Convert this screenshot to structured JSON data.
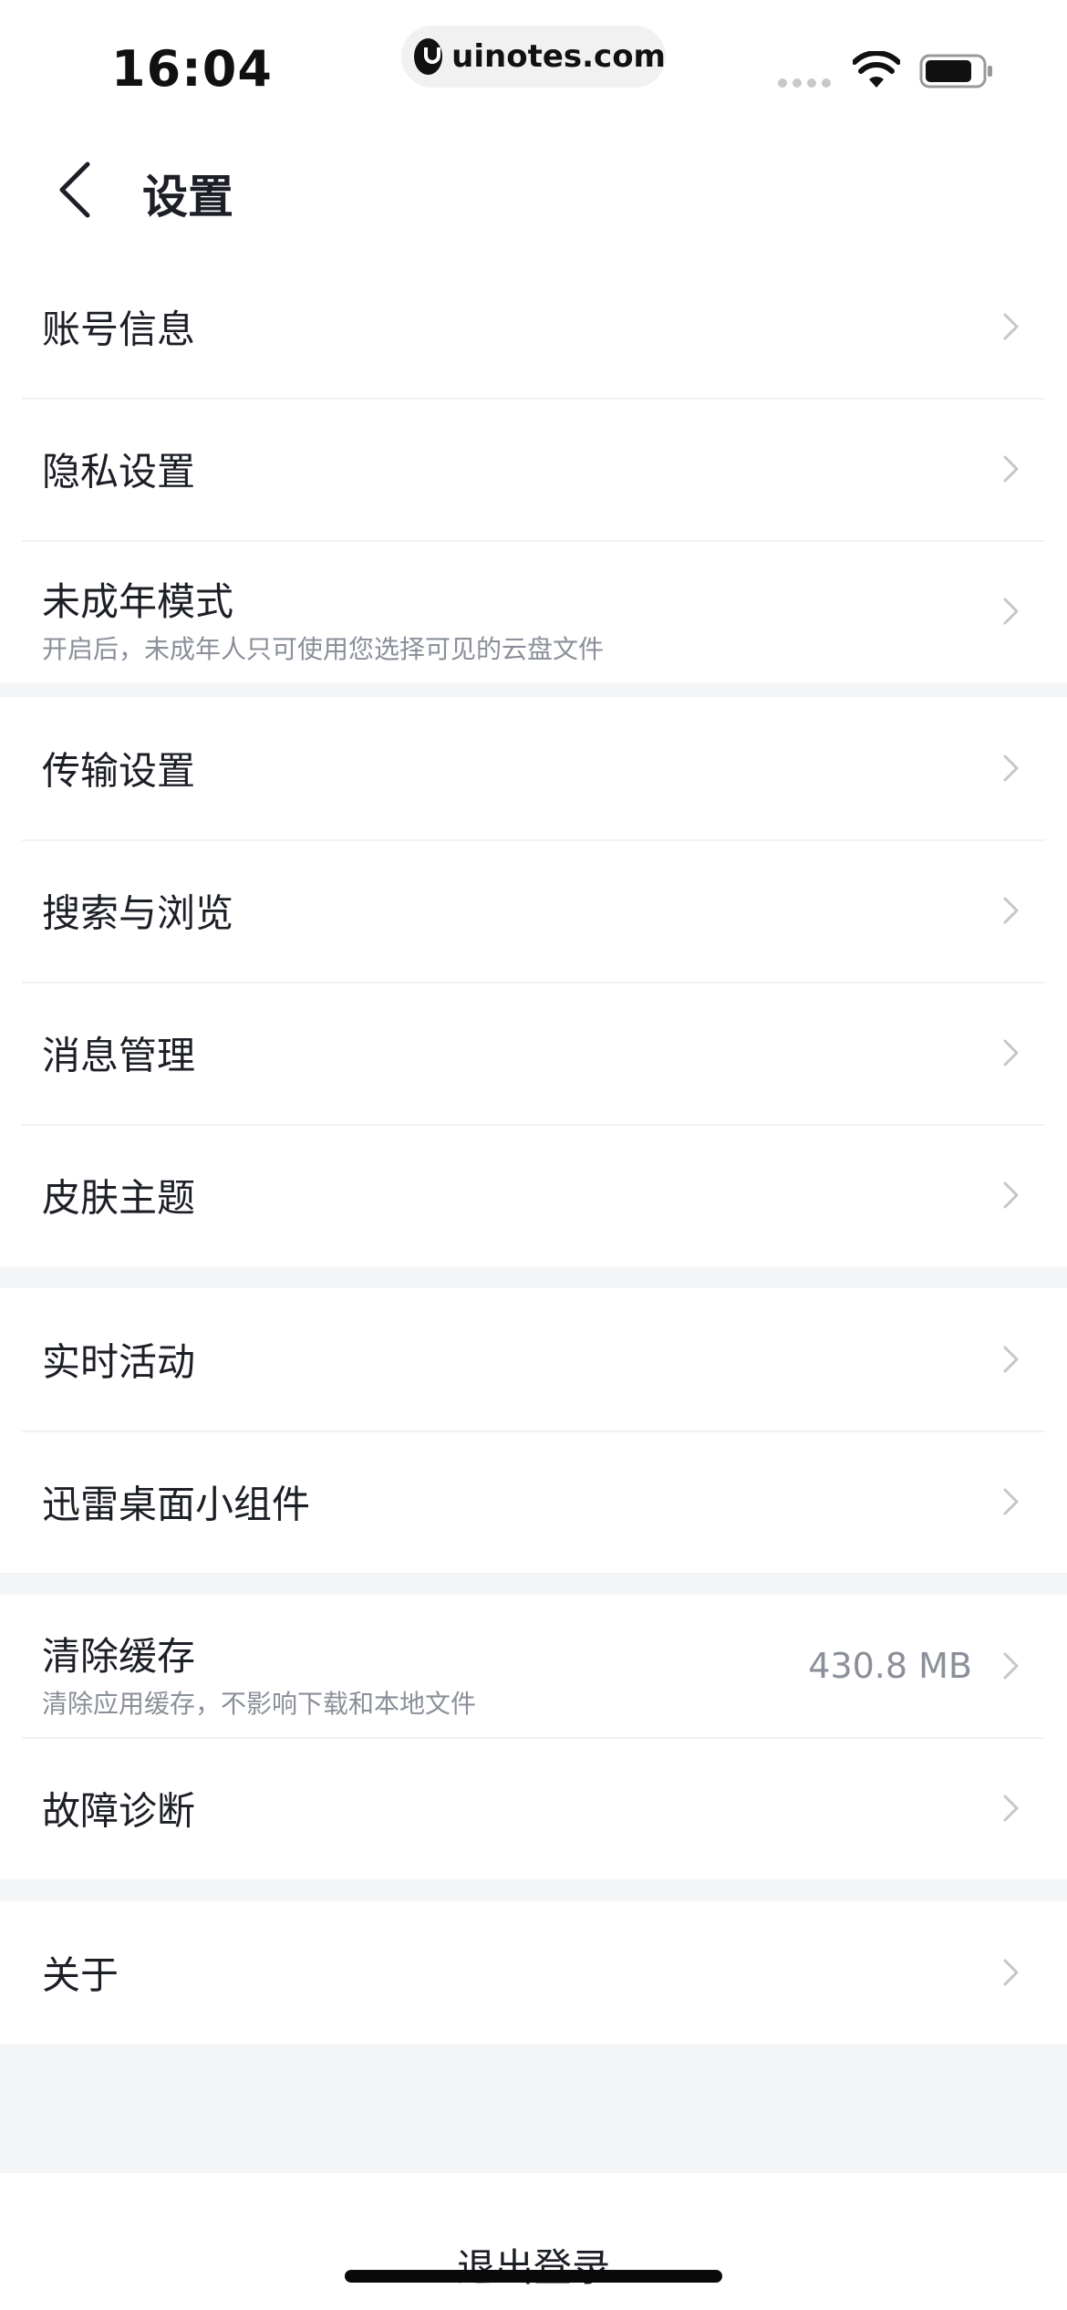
{
  "status_bar": {
    "time": "16:04",
    "url": "uinotes.com",
    "icons": [
      "signal-icon",
      "wifi-icon",
      "battery-icon"
    ]
  },
  "nav": {
    "title": "设置",
    "back_icon": "chevron-left-icon"
  },
  "groups": [
    {
      "items": [
        {
          "title": "账号信息"
        },
        {
          "title": "隐私设置"
        },
        {
          "title": "未成年模式",
          "subtitle": "开启后，未成年人只可使用您选择可见的云盘文件"
        }
      ]
    },
    {
      "items": [
        {
          "title": "传输设置"
        },
        {
          "title": "搜索与浏览"
        },
        {
          "title": "消息管理"
        },
        {
          "title": "皮肤主题"
        }
      ]
    },
    {
      "items": [
        {
          "title": "实时活动"
        },
        {
          "title": "迅雷桌面小组件"
        }
      ]
    },
    {
      "items": [
        {
          "title": "清除缓存",
          "subtitle": "清除应用缓存，不影响下载和本地文件",
          "value": "430.8 MB"
        },
        {
          "title": "故障诊断"
        }
      ]
    },
    {
      "items": [
        {
          "title": "关于"
        }
      ]
    }
  ],
  "logout": {
    "label": "退出登录"
  },
  "colors": {
    "background": "#f4f5f7",
    "card": "#ffffff",
    "text": "#1c1f26",
    "secondary_text": "#8a8f99",
    "chevron": "#c3c6cc"
  }
}
